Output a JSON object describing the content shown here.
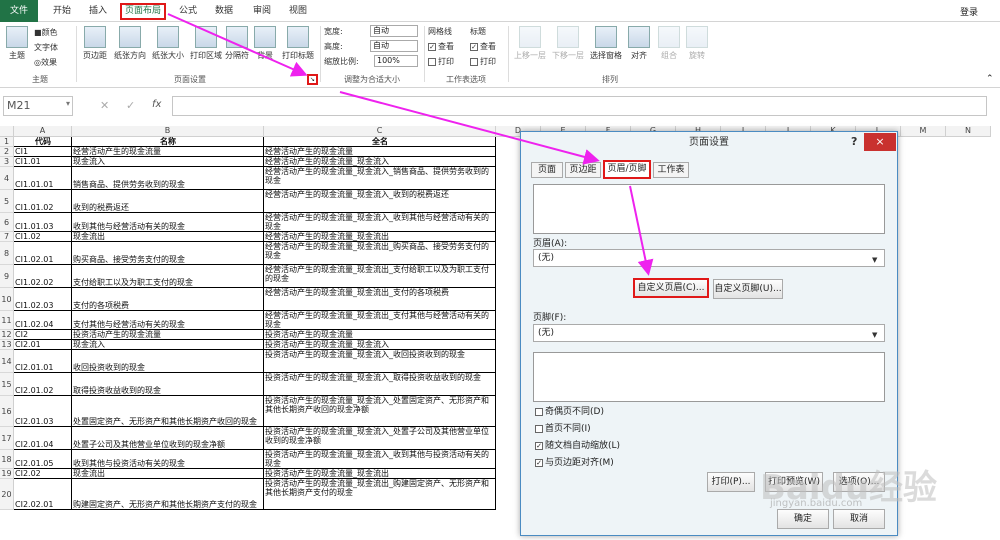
{
  "tabs": [
    "文件",
    "开始",
    "插入",
    "页面布局",
    "公式",
    "数据",
    "审阅",
    "视图"
  ],
  "login": "登录",
  "ribbon": {
    "theme": {
      "main": "主题",
      "color": "颜色",
      "font": "字体",
      "effect": "效果",
      "group": "主题"
    },
    "pagesetup": {
      "margin": "页边距",
      "orient": "纸张方向",
      "size": "纸张大小",
      "area": "打印区域",
      "breaks": "分隔符",
      "background": "背景",
      "titles": "打印标题",
      "group": "页面设置"
    },
    "scale": {
      "width_label": "宽度:",
      "width_val": "自动",
      "height_label": "高度:",
      "height_val": "自动",
      "scale_label": "缩放比例:",
      "scale_val": "100%",
      "group": "调整为合适大小"
    },
    "sheetopts": {
      "grid": "网格线",
      "heading": "标题",
      "view": "查看",
      "print": "打印",
      "group": "工作表选项"
    },
    "arrange": {
      "fwd": "上移一层",
      "back": "下移一层",
      "pane": "选择窗格",
      "align": "对齐",
      "group_btn": "组合",
      "rotate": "旋转",
      "group": "排列"
    }
  },
  "namebox": "M21",
  "fx": "fx",
  "cols": [
    "A",
    "B",
    "C",
    "D",
    "E",
    "F",
    "G",
    "H",
    "I",
    "J",
    "K",
    "L",
    "M",
    "N"
  ],
  "rows": [
    {
      "n": "1",
      "a": "代码",
      "b": "名称",
      "c": "全名",
      "h": 9
    },
    {
      "n": "2",
      "a": "CI1",
      "b": "经营活动产生的现金流量",
      "c": "经营活动产生的现金流量",
      "h": 9
    },
    {
      "n": "3",
      "a": "CI1.01",
      "b": "现金流入",
      "c": "经营活动产生的现金流量_现金流入",
      "h": 9
    },
    {
      "n": "4",
      "a": "CI1.01.01",
      "b": "销售商品、提供劳务收到的现金",
      "c": "经营活动产生的现金流量_现金流入_销售商品、提供劳务收到的现金",
      "h": 22
    },
    {
      "n": "5",
      "a": "CI1.01.02",
      "b": "收到的税费返还",
      "c": "经营活动产生的现金流量_现金流入_收到的税费返还",
      "h": 22
    },
    {
      "n": "6",
      "a": "CI1.01.03",
      "b": "收到其他与经营活动有关的现金",
      "c": "经营活动产生的现金流量_现金流入_收到其他与经营活动有关的现金",
      "h": 18
    },
    {
      "n": "7",
      "a": "CI1.02",
      "b": "现金流出",
      "c": "经营活动产生的现金流量_现金流出",
      "h": 9
    },
    {
      "n": "8",
      "a": "CI1.02.01",
      "b": "购买商品、接受劳务支付的现金",
      "c": "经营活动产生的现金流量_现金流出_购买商品、接受劳务支付的现金",
      "h": 22
    },
    {
      "n": "9",
      "a": "CI1.02.02",
      "b": "支付给职工以及为职工支付的现金",
      "c": "经营活动产生的现金流量_现金流出_支付给职工以及为职工支付的现金",
      "h": 22
    },
    {
      "n": "10",
      "a": "CI1.02.03",
      "b": "支付的各项税费",
      "c": "经营活动产生的现金流量_现金流出_支付的各项税费",
      "h": 22
    },
    {
      "n": "11",
      "a": "CI1.02.04",
      "b": "支付其他与经营活动有关的现金",
      "c": "经营活动产生的现金流量_现金流出_支付其他与经营活动有关的现金",
      "h": 18
    },
    {
      "n": "12",
      "a": "CI2",
      "b": "投资活动产生的现金流量",
      "c": "投资活动产生的现金流量",
      "h": 9
    },
    {
      "n": "13",
      "a": "CI2.01",
      "b": "现金流入",
      "c": "投资活动产生的现金流量_现金流入",
      "h": 9
    },
    {
      "n": "14",
      "a": "CI2.01.01",
      "b": "收回投资收到的现金",
      "c": "投资活动产生的现金流量_现金流入_收回投资收到的现金",
      "h": 22
    },
    {
      "n": "15",
      "a": "CI2.01.02",
      "b": "取得投资收益收到的现金",
      "c": "投资活动产生的现金流量_现金流入_取得投资收益收到的现金",
      "h": 22
    },
    {
      "n": "16",
      "a": "CI2.01.03",
      "b": "处置固定资产、无形资产和其他长期资产收回的现金",
      "c": "投资活动产生的现金流量_现金流入_处置固定资产、无形资产和其他长期资产收回的现金净额",
      "h": 30
    },
    {
      "n": "17",
      "a": "CI2.01.04",
      "b": "处置子公司及其他营业单位收到的现金净额",
      "c": "投资活动产生的现金流量_现金流入_处置子公司及其他营业单位收到的现金净额",
      "h": 22
    },
    {
      "n": "18",
      "a": "CI2.01.05",
      "b": "收到其他与投资活动有关的现金",
      "c": "投资活动产生的现金流量_现金流入_收到其他与投资活动有关的现金",
      "h": 18
    },
    {
      "n": "19",
      "a": "CI2.02",
      "b": "现金流出",
      "c": "投资活动产生的现金流量_现金流出",
      "h": 9
    },
    {
      "n": "20",
      "a": "CI2.02.01",
      "b": "购建固定资产、无形资产和其他长期资产支付的现金",
      "c": "投资活动产生的现金流量_现金流出_购建固定资产、无形资产和其他长期资产支付的现金",
      "h": 30
    }
  ],
  "dialog": {
    "title": "页面设置",
    "help": "?",
    "close": "×",
    "tabs": [
      "页面",
      "页边距",
      "页眉/页脚",
      "工作表"
    ],
    "header_label": "页眉(A):",
    "header_val": "(无)",
    "custom_header": "自定义页眉(C)...",
    "custom_footer": "自定义页脚(U)...",
    "footer_label": "页脚(F):",
    "footer_val": "(无)",
    "checks": [
      {
        "label": "奇偶页不同(D)",
        "checked": false
      },
      {
        "label": "首页不同(I)",
        "checked": false
      },
      {
        "label": "随文档自动缩放(L)",
        "checked": true
      },
      {
        "label": "与页边距对齐(M)",
        "checked": true
      }
    ],
    "print": "打印(P)...",
    "preview": "打印预览(W)",
    "options": "选项(O)...",
    "ok": "确定",
    "cancel": "取消"
  },
  "watermark": "Baidu经验",
  "watermark_sub": "jingyan.baidu.com",
  "accent": "#217346",
  "highlight": "#e01818",
  "arrow_color": "#ee22ee"
}
